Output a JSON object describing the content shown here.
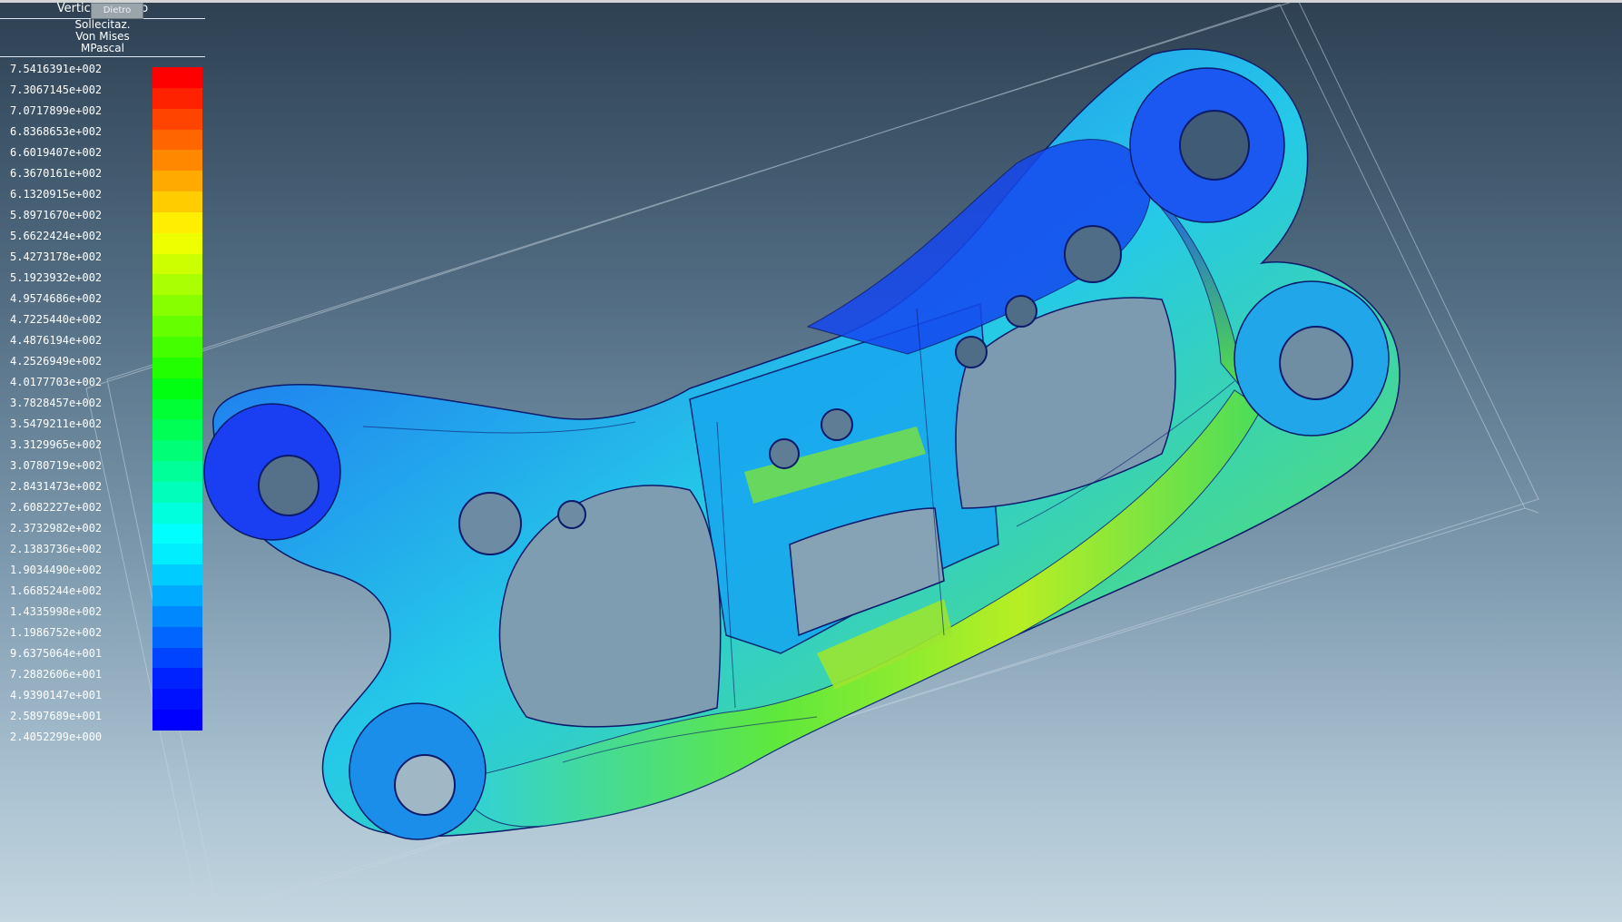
{
  "header": {
    "view_title": "Verticale Dietro",
    "tag_label": "Dietro",
    "quantity": "Sollecitaz.",
    "criterion": "Von Mises",
    "unit": "MPascal"
  },
  "legend": {
    "values": [
      "7.5416391e+002",
      "7.3067145e+002",
      "7.0717899e+002",
      "6.8368653e+002",
      "6.6019407e+002",
      "6.3670161e+002",
      "6.1320915e+002",
      "5.8971670e+002",
      "5.6622424e+002",
      "5.4273178e+002",
      "5.1923932e+002",
      "4.9574686e+002",
      "4.7225440e+002",
      "4.4876194e+002",
      "4.2526949e+002",
      "4.0177703e+002",
      "3.7828457e+002",
      "3.5479211e+002",
      "3.3129965e+002",
      "3.0780719e+002",
      "2.8431473e+002",
      "2.6082227e+002",
      "2.3732982e+002",
      "2.1383736e+002",
      "1.9034490e+002",
      "1.6685244e+002",
      "1.4335998e+002",
      "1.1986752e+002",
      "9.6375064e+001",
      "7.2882606e+001",
      "4.9390147e+001",
      "2.5897689e+001",
      "2.4052299e+000"
    ],
    "colors": [
      "#ff0000",
      "#ff2200",
      "#ff4400",
      "#ff6600",
      "#ff8800",
      "#ffaa00",
      "#ffcc00",
      "#ffee00",
      "#eeff00",
      "#ccff00",
      "#aaff00",
      "#88ff00",
      "#66ff00",
      "#44ff00",
      "#22ff00",
      "#00ff11",
      "#00ff33",
      "#00ff55",
      "#00ff77",
      "#00ff99",
      "#00ffbb",
      "#00ffdd",
      "#00ffff",
      "#00eeff",
      "#00ccff",
      "#00aaff",
      "#0088ff",
      "#0066ff",
      "#0044ff",
      "#0022ff",
      "#0011ff",
      "#0000ff"
    ]
  },
  "model_colors": {
    "low": "#0a3dff",
    "mid": "#1fd8e6",
    "high": "#5ef23a",
    "peak": "#d6f01e"
  }
}
